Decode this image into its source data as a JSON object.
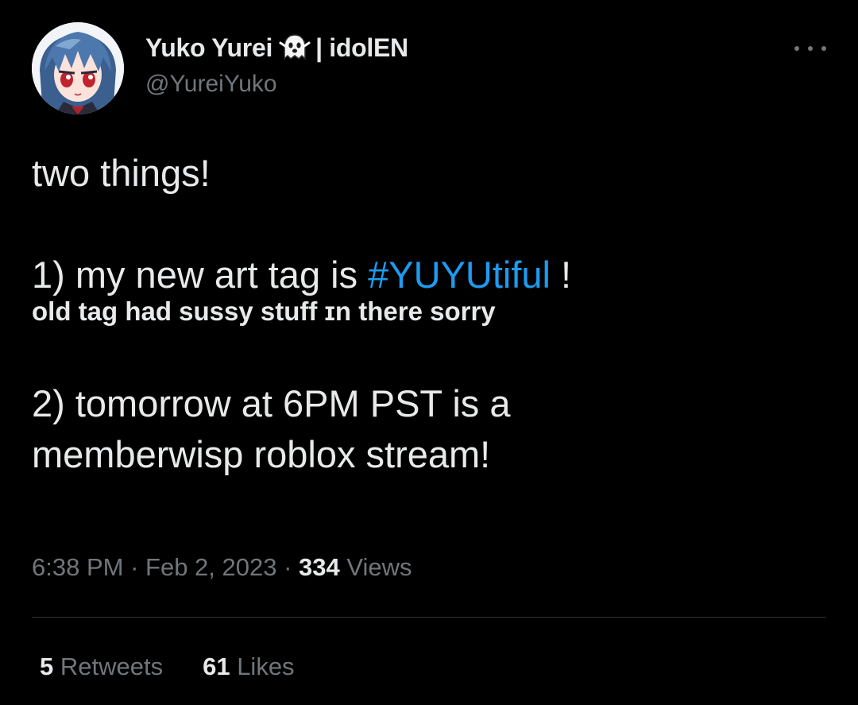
{
  "author": {
    "display_name": "Yuko Yurei",
    "name_suffix": "| idolEN",
    "handle": "@YureiYuko",
    "avatar_icon": "anime-avatar",
    "badge_icon": "ghost-icon"
  },
  "menu": {
    "icon": "more-horizontal-icon"
  },
  "tweet": {
    "line1": "two things!",
    "line2_prefix": "1) my new art tag is ",
    "hashtag": "#YUYUtiful",
    "line2_suffix": " !",
    "line3": "old tag had sussy stuff ɪn there sorry",
    "line4": "2) tomorrow at 6PM PST is a",
    "line5": "memberwisp roblox stream!"
  },
  "meta": {
    "time": "6:38 PM",
    "separator": " · ",
    "date": "Feb 2, 2023",
    "views_count": "334",
    "views_label": " Views"
  },
  "stats": {
    "retweets_count": "5",
    "retweets_label": " Retweets",
    "likes_count": "61",
    "likes_label": " Likes"
  },
  "colors": {
    "background": "#000000",
    "text": "#e7e9ea",
    "secondary": "#71767b",
    "link": "#1d9bf0",
    "divider": "#2f3336"
  }
}
